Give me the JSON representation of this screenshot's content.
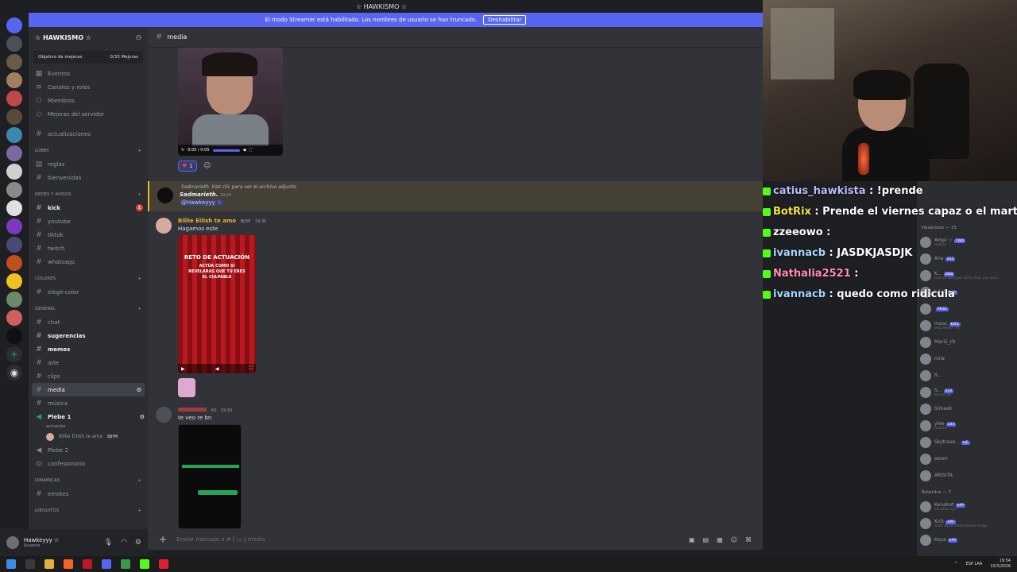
{
  "window": {
    "title": "☆ HAWKISMO ☆"
  },
  "banner": {
    "text": "El modo Streamer está habilitado. Los nombres de usuario se han truncado.",
    "button": "Deshabilitar"
  },
  "server": {
    "name": "☆ HAWKISMO ☆",
    "boost_label": "Objetivo de mejoras",
    "boost_count": "0/33 Mejoras"
  },
  "sidebar": {
    "top_items": [
      "Eventos",
      "Canales y roles",
      "Miembros",
      "Mejoras del servidor"
    ],
    "updates_channel": "actualizaciones",
    "categories": {
      "lobby": "LOBBY",
      "redes": "REDES Y AVISOS",
      "colores": "COLORES",
      "general": "GENERAL",
      "dinamicas": "DINAMICAS",
      "juegitos": "JUEGUITOS"
    },
    "lobby": [
      "reglas",
      "bienvenidas"
    ],
    "redes": [
      "kick",
      "youtube",
      "tiktok",
      "twitch",
      "whatsapp"
    ],
    "colores": [
      "elegir-color"
    ],
    "general": [
      "chat",
      "sugerencias",
      "memes",
      "arte",
      "clips",
      "media",
      "música"
    ],
    "voice": {
      "plebe1": "Plebe 1",
      "plebe1_activity": "actuación",
      "plebe1_member": "Billie Eilish te amo",
      "plebe1_member_tag": "BJHM",
      "plebe2": "Plebe 2",
      "confesionario": "confesionario"
    },
    "dinamicas": [
      "emotes"
    ],
    "kick_badge": "1"
  },
  "user": {
    "name": "Hawkeyyy ☆",
    "status": "Ausente"
  },
  "chat": {
    "channel": "media",
    "video_time": "0:05 / 0:05",
    "reaction_count": "1",
    "reply_snippet": "Sadmarieth. Haz clic para ver el archivo adjunto",
    "reply_author": "Sadmarieth.",
    "reply_time": "19:23",
    "reply_mention": "@Hawkeyyy ☆",
    "msg1_author": "Billie Eilish te amo",
    "msg1_tag": "BJHM",
    "msg1_time": "19:36",
    "msg1_text": "Hagamos este",
    "poster_title": "RETO DE ACTUACIÓN",
    "poster_sub": "ACTÚA COMO SI REVELARAS QUE TÚ ERES EL CULPABLE",
    "msg2_tag": "XO",
    "msg2_time": "19:50",
    "msg2_text": "te veo re bn",
    "composer_placeholder": "Enviar mensaje a # ⌈ ▭ ⌋ media"
  },
  "stream_chat": [
    {
      "user": "catius_hawkista",
      "text": "!prende",
      "color": "#b9bbf8"
    },
    {
      "user": "BotRix",
      "text": "Prende el viernes capaz o el martes",
      "color": "#f0e442"
    },
    {
      "user": "zzeeowo",
      "text": "",
      "color": "#ffffff"
    },
    {
      "user": "ivannacb",
      "text": "JASDKJASDJK",
      "color": "#a7d7ff"
    },
    {
      "user": "Nathalia2521",
      "text": "",
      "color": "#ff8fb0"
    },
    {
      "user": "ivannacb",
      "text": "quedo como ridicula",
      "color": "#a7d7ff"
    }
  ],
  "members": {
    "hawkistas_header": "Hawkistas — 15",
    "list": [
      {
        "name": "Ampi ☆",
        "sub": "Roblox",
        "tag": "TWD"
      },
      {
        "name": "Ana",
        "sub": "",
        "tag": "333"
      },
      {
        "name": "K...",
        "sub": "ouh en sorry,im sorry that you love...",
        "tag": "DBB"
      },
      {
        "name": "lulu!",
        "sub": "",
        "tag": "Pol0"
      },
      {
        "name": "",
        "sub": "",
        "tag": "PRSE"
      },
      {
        "name": "maac",
        "sub": "VALORANT +1",
        "tag": "KISS"
      },
      {
        "name": "Mariii_ch",
        "sub": "",
        "tag": ""
      },
      {
        "name": "mila",
        "sub": "",
        "tag": ""
      },
      {
        "name": "R...",
        "sub": "",
        "tag": ""
      },
      {
        "name": "S...",
        "sub": "Minecraft",
        "tag": "333"
      },
      {
        "name": "Simeek",
        "sub": "",
        "tag": ""
      },
      {
        "name": "ylee",
        "sub": "Roblox",
        "tag": "333"
      },
      {
        "name": "Skytraxe...",
        "sub": "",
        "tag": "LIE"
      },
      {
        "name": "seren",
        "sub": "",
        "tag": ""
      },
      {
        "name": "ARISITA",
        "sub": "",
        "tag": ""
      }
    ],
    "bots_header": "Botardos — 7",
    "bots": [
      {
        "name": "Kenabot",
        "sub": "kenabot.xyz",
        "tag": "APP"
      },
      {
        "name": "Kick",
        "sub": "Sent 3618 notifications today",
        "tag": "APP"
      },
      {
        "name": "Koya",
        "sub": "",
        "tag": "APP"
      }
    ]
  },
  "taskbar": {
    "lang": "ESP LAA",
    "time": "19:54",
    "date": "10/3/2026"
  }
}
